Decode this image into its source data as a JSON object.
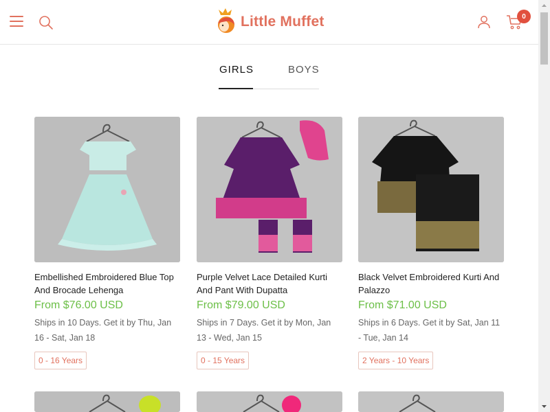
{
  "header": {
    "brand": "Little Muffet",
    "cart_count": "0",
    "accent_color": "#e1715e"
  },
  "icons": {
    "menu": "hamburger-icon",
    "search": "search-icon",
    "account": "user-icon",
    "cart": "cart-icon"
  },
  "tabs": [
    {
      "label": "GIRLS",
      "active": true
    },
    {
      "label": "BOYS",
      "active": false
    }
  ],
  "products": [
    {
      "title": "Embellished Embroidered Blue Top And Brocade Lehenga",
      "price": "From $76.00 USD",
      "shipping": "Ships in 10 Days. Get it by Thu, Jan 16 - Sat, Jan 18",
      "age": "0 - 16 Years"
    },
    {
      "title": "Purple Velvet Lace Detailed Kurti And Pant With Dupatta",
      "price": "From $79.00 USD",
      "shipping": "Ships in 7 Days. Get it by Mon, Jan 13 - Wed, Jan 15",
      "age": "0 - 15 Years"
    },
    {
      "title": "Black Velvet Embroidered Kurti And Palazzo",
      "price": "From $71.00 USD",
      "shipping": "Ships in 6 Days. Get it by Sat, Jan 11 - Tue, Jan 14",
      "age": "2 Years - 10 Years"
    }
  ],
  "colors": {
    "price_green": "#6cbf47",
    "badge_red": "#e1503e"
  }
}
